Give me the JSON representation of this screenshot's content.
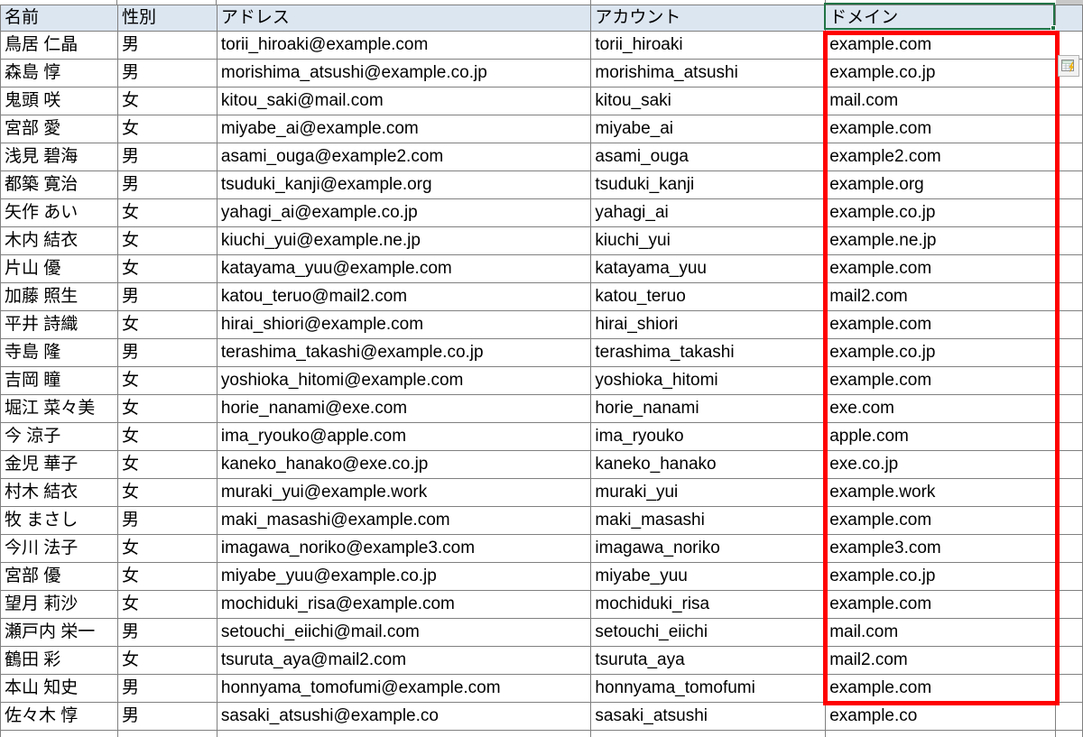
{
  "app": {
    "type": "spreadsheet",
    "active_cell_value": "ドメイン",
    "selection_color": "#217346",
    "header_fill": "#dce6f1",
    "gridline_color": "#808080",
    "annotation_color": "#ff0000"
  },
  "table": {
    "headers": [
      "名前",
      "性別",
      "アドレス",
      "アカウント",
      "ドメイン"
    ],
    "rows": [
      {
        "name": "鳥居 仁晶",
        "gender": "男",
        "address": "torii_hiroaki@example.com",
        "account": "torii_hiroaki",
        "domain": "example.com"
      },
      {
        "name": "森島 惇",
        "gender": "男",
        "address": "morishima_atsushi@example.co.jp",
        "account": "morishima_atsushi",
        "domain": "example.co.jp"
      },
      {
        "name": "鬼頭 咲",
        "gender": "女",
        "address": "kitou_saki@mail.com",
        "account": "kitou_saki",
        "domain": "mail.com"
      },
      {
        "name": "宮部 愛",
        "gender": "女",
        "address": "miyabe_ai@example.com",
        "account": "miyabe_ai",
        "domain": "example.com"
      },
      {
        "name": "浅見 碧海",
        "gender": "男",
        "address": "asami_ouga@example2.com",
        "account": "asami_ouga",
        "domain": "example2.com"
      },
      {
        "name": "都築 寛治",
        "gender": "男",
        "address": "tsuduki_kanji@example.org",
        "account": "tsuduki_kanji",
        "domain": "example.org"
      },
      {
        "name": "矢作 あい",
        "gender": "女",
        "address": "yahagi_ai@example.co.jp",
        "account": "yahagi_ai",
        "domain": "example.co.jp"
      },
      {
        "name": "木内 結衣",
        "gender": "女",
        "address": "kiuchi_yui@example.ne.jp",
        "account": "kiuchi_yui",
        "domain": "example.ne.jp"
      },
      {
        "name": "片山 優",
        "gender": "女",
        "address": "katayama_yuu@example.com",
        "account": "katayama_yuu",
        "domain": "example.com"
      },
      {
        "name": "加藤 照生",
        "gender": "男",
        "address": "katou_teruo@mail2.com",
        "account": "katou_teruo",
        "domain": "mail2.com"
      },
      {
        "name": "平井 詩織",
        "gender": "女",
        "address": "hirai_shiori@example.com",
        "account": "hirai_shiori",
        "domain": "example.com"
      },
      {
        "name": "寺島 隆",
        "gender": "男",
        "address": "terashima_takashi@example.co.jp",
        "account": "terashima_takashi",
        "domain": "example.co.jp"
      },
      {
        "name": "吉岡 瞳",
        "gender": "女",
        "address": "yoshioka_hitomi@example.com",
        "account": "yoshioka_hitomi",
        "domain": "example.com"
      },
      {
        "name": "堀江 菜々美",
        "gender": "女",
        "address": "horie_nanami@exe.com",
        "account": "horie_nanami",
        "domain": "exe.com"
      },
      {
        "name": "今 涼子",
        "gender": "女",
        "address": "ima_ryouko@apple.com",
        "account": "ima_ryouko",
        "domain": "apple.com"
      },
      {
        "name": "金児 華子",
        "gender": "女",
        "address": "kaneko_hanako@exe.co.jp",
        "account": "kaneko_hanako",
        "domain": "exe.co.jp"
      },
      {
        "name": "村木 結衣",
        "gender": "女",
        "address": "muraki_yui@example.work",
        "account": "muraki_yui",
        "domain": "example.work"
      },
      {
        "name": "牧 まさし",
        "gender": "男",
        "address": "maki_masashi@example.com",
        "account": "maki_masashi",
        "domain": "example.com"
      },
      {
        "name": "今川 法子",
        "gender": "女",
        "address": "imagawa_noriko@example3.com",
        "account": "imagawa_noriko",
        "domain": "example3.com"
      },
      {
        "name": "宮部 優",
        "gender": "女",
        "address": "miyabe_yuu@example.co.jp",
        "account": "miyabe_yuu",
        "domain": "example.co.jp"
      },
      {
        "name": "望月 莉沙",
        "gender": "女",
        "address": "mochiduki_risa@example.com",
        "account": "mochiduki_risa",
        "domain": "example.com"
      },
      {
        "name": "瀬戸内 栄一",
        "gender": "男",
        "address": "setouchi_eiichi@mail.com",
        "account": "setouchi_eiichi",
        "domain": "mail.com"
      },
      {
        "name": "鶴田 彩",
        "gender": "女",
        "address": "tsuruta_aya@mail2.com",
        "account": "tsuruta_aya",
        "domain": "mail2.com"
      },
      {
        "name": "本山 知史",
        "gender": "男",
        "address": "honnyama_tomofumi@example.com",
        "account": "honnyama_tomofumi",
        "domain": "example.com"
      },
      {
        "name": "佐々木 惇",
        "gender": "男",
        "address": "sasaki_atsushi@example.co",
        "account": "sasaki_atsushi",
        "domain": "example.co"
      }
    ]
  },
  "quick_analysis": {
    "icon": "quick-analysis-icon",
    "tooltip": "クイック分析"
  }
}
